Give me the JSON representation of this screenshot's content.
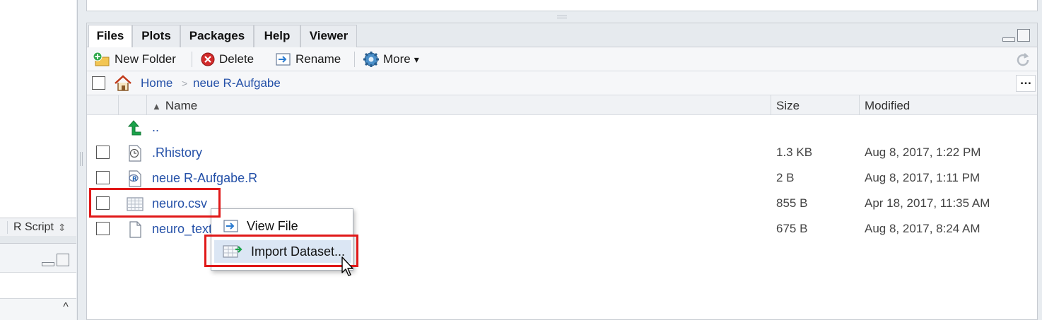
{
  "left_panel": {
    "editor_footer": {
      "file_type": "R Script",
      "file_type_arrows": "⇕"
    },
    "scroll_up": "^"
  },
  "files_pane": {
    "tabs": [
      {
        "label": "Files",
        "active": true
      },
      {
        "label": "Plots",
        "active": false
      },
      {
        "label": "Packages",
        "active": false
      },
      {
        "label": "Help",
        "active": false
      },
      {
        "label": "Viewer",
        "active": false
      }
    ],
    "toolbar": {
      "new_folder": "New Folder",
      "delete": "Delete",
      "rename": "Rename",
      "more": "More",
      "more_arrow": "▾"
    },
    "breadcrumb": {
      "home": "Home",
      "separator": ">",
      "folder": "neue R-Aufgabe",
      "ellipsis": "…"
    },
    "columns": {
      "name": "Name",
      "sort_indicator": "▲",
      "size": "Size",
      "modified": "Modified"
    },
    "parent_dir": "..",
    "files": [
      {
        "name": ".Rhistory",
        "size": "1.3 KB",
        "modified": "Aug 8, 2017, 1:22 PM",
        "icon": "rhistory-icon"
      },
      {
        "name": "neue R-Aufgabe.R",
        "size": "2 B",
        "modified": "Aug 8, 2017, 1:11 PM",
        "icon": "r-script-icon"
      },
      {
        "name": "neuro.csv",
        "size": "855 B",
        "modified": "Apr 18, 2017, 11:35 AM",
        "icon": "csv-table-icon"
      },
      {
        "name": "neuro_text",
        "size": "675 B",
        "modified": "Aug 8, 2017, 8:24 AM",
        "icon": "text-file-icon"
      }
    ]
  },
  "context_menu": {
    "items": [
      {
        "label": "View File",
        "icon": "view-file-icon"
      },
      {
        "label": "Import Dataset...",
        "icon": "import-dataset-icon",
        "hovered": true
      }
    ]
  },
  "colors": {
    "link": "#2551a8",
    "highlight_box": "#e01818",
    "hover": "#dbe6f4",
    "green_arrow": "#1aa34a"
  }
}
